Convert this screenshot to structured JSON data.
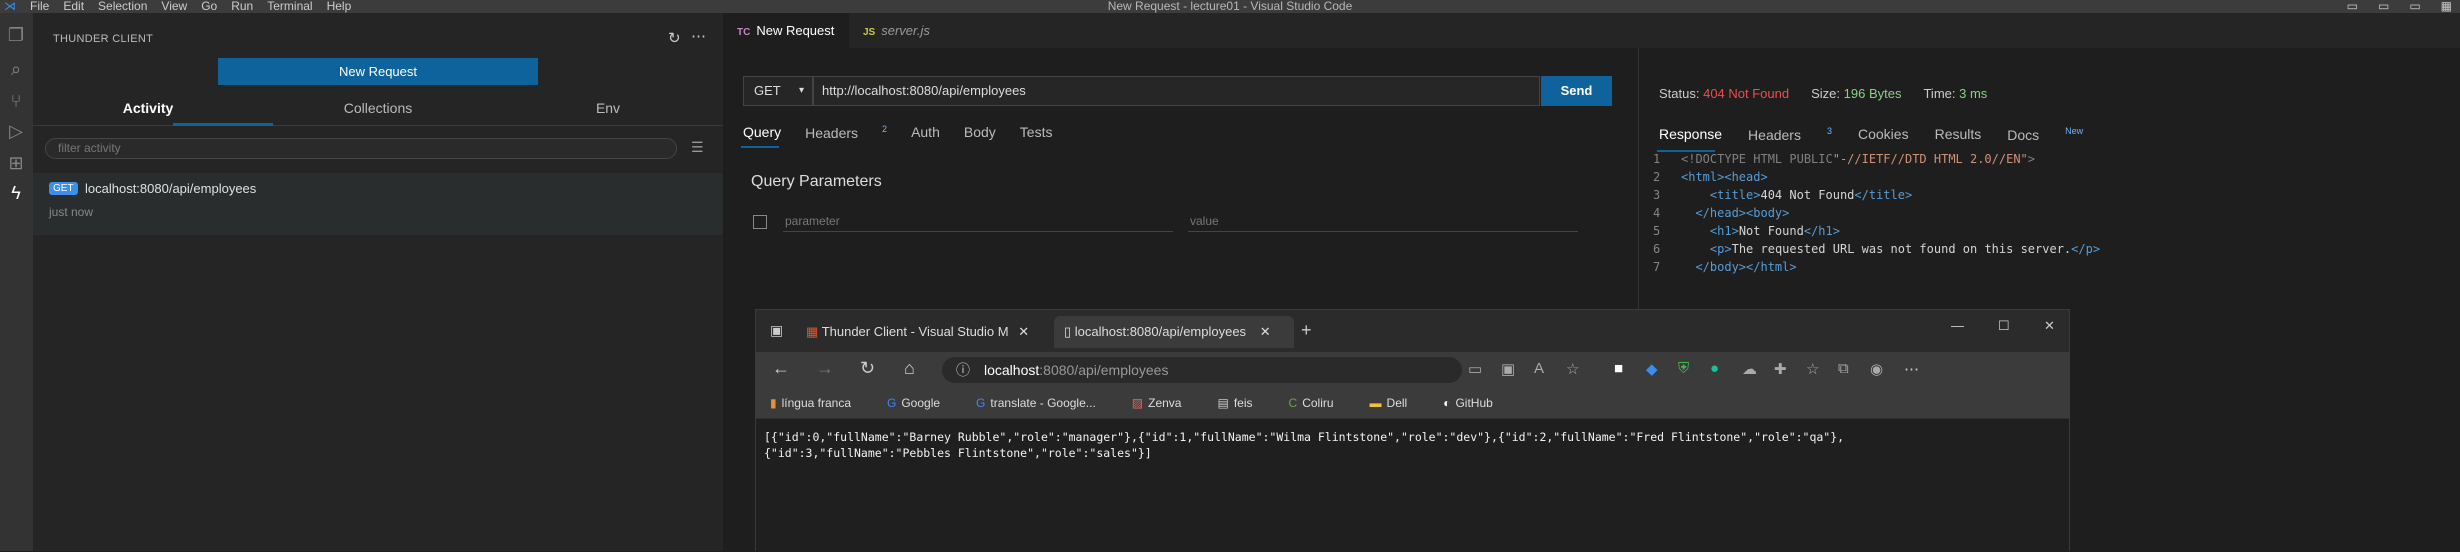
{
  "titlebar": {
    "menu": [
      "File",
      "Edit",
      "Selection",
      "View",
      "Go",
      "Run",
      "Terminal",
      "Help"
    ],
    "title": "New Request - lecture01 - Visual Studio Code"
  },
  "sidebar": {
    "header": "THUNDER CLIENT",
    "new_request": "New Request",
    "tabs": [
      "Activity",
      "Collections",
      "Env"
    ],
    "filter_placeholder": "filter activity",
    "history": {
      "method": "GET",
      "url": "localhost:8080/api/employees",
      "time": "just now"
    }
  },
  "editor_tabs": [
    {
      "badge": "TC",
      "label": "New Request",
      "close": "×"
    },
    {
      "badge": "JS",
      "label": "server.js"
    }
  ],
  "request": {
    "method": "GET",
    "url": "http://localhost:8080/api/employees",
    "send": "Send",
    "tabs": [
      "Query",
      "Headers",
      "Auth",
      "Body",
      "Tests"
    ],
    "headers_count": "2",
    "query_title": "Query Parameters",
    "param_placeholder": "parameter",
    "value_placeholder": "value"
  },
  "response": {
    "status_label": "Status:",
    "status_value": "404 Not Found",
    "size_label": "Size:",
    "size_value": "196 Bytes",
    "time_label": "Time:",
    "time_value": "3 ms",
    "tabs": [
      "Response",
      "Headers",
      "Cookies",
      "Results",
      "Docs"
    ],
    "headers_count": "3",
    "docs_sup": "New",
    "line_numbers": [
      "1",
      "2",
      "3",
      "4",
      "5",
      "6",
      "7"
    ],
    "colors": {
      "error": "#f14c4c",
      "ok": "#89d185",
      "accent": "#0e639c"
    }
  },
  "browser": {
    "tabs": [
      "Thunder Client - Visual Studio M",
      "localhost:8080/api/employees"
    ],
    "address_host": "localhost",
    "address_path": ":8080/api/employees",
    "bookmarks": [
      "língua franca",
      "Google",
      "translate - Google...",
      "Zenva",
      "feis",
      "Coliru",
      "Dell",
      "GitHub"
    ],
    "body": "[{\"id\":0,\"fullName\":\"Barney Rubble\",\"role\":\"manager\"},{\"id\":1,\"fullName\":\"Wilma Flintstone\",\"role\":\"dev\"},{\"id\":2,\"fullName\":\"Fred Flintstone\",\"role\":\"qa\"},\n{\"id\":3,\"fullName\":\"Pebbles Flintstone\",\"role\":\"sales\"}]"
  }
}
